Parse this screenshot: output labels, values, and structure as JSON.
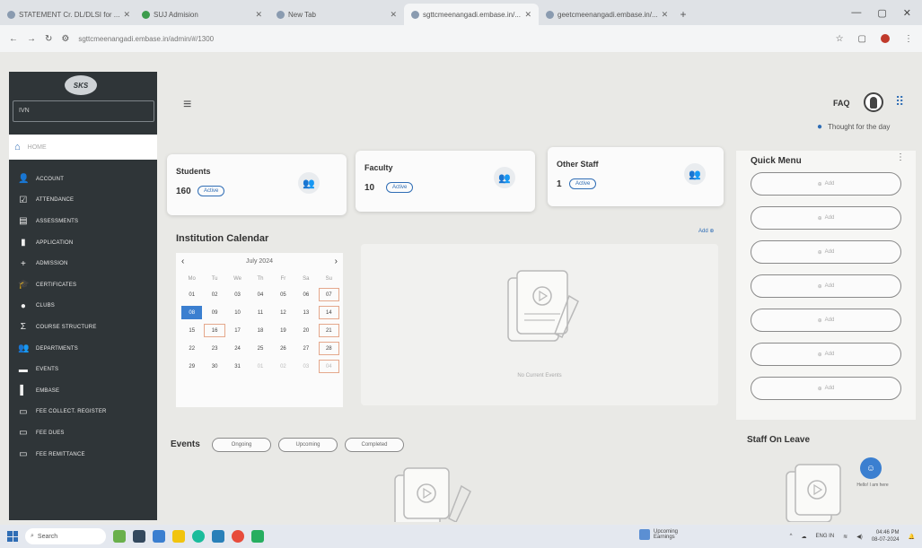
{
  "browser": {
    "tabs": [
      {
        "title": "STATEMENT Cr. DL/DLSI for ..."
      },
      {
        "title": "SUJ Admision"
      },
      {
        "title": "New Tab"
      },
      {
        "title": "sgttcmeenangadi.embase.in/..."
      },
      {
        "title": "geetcmeenangadi.embase.in/..."
      }
    ],
    "url": "sgttcmeenangadi.embase.in/admin/#/1300"
  },
  "sidebar": {
    "logo_text": "SKS",
    "search_value": "IVN",
    "home_label": "HOME",
    "items": [
      {
        "label": "ACCOUNT",
        "icon": "person-icon"
      },
      {
        "label": "ATTENDANCE",
        "icon": "check-square-icon"
      },
      {
        "label": "ASSESSMENTS",
        "icon": "clipboard-icon"
      },
      {
        "label": "APPLICATION",
        "icon": "document-icon"
      },
      {
        "label": "ADMISSION",
        "icon": "person-add-icon"
      },
      {
        "label": "CERTIFICATES",
        "icon": "graduation-cap-icon"
      },
      {
        "label": "CLUBS",
        "icon": "group-circle-icon"
      },
      {
        "label": "COURSE STRUCTURE",
        "icon": "sigma-icon"
      },
      {
        "label": "DEPARTMENTS",
        "icon": "people-icon"
      },
      {
        "label": "EVENTS",
        "icon": "event-icon"
      },
      {
        "label": "EMBASE",
        "icon": "book-icon"
      },
      {
        "label": "FEE COLLECT. REGISTER",
        "icon": "register-icon"
      },
      {
        "label": "FEE DUES",
        "icon": "fee-icon"
      },
      {
        "label": "FEE REMITTANCE",
        "icon": "remittance-icon"
      }
    ]
  },
  "header": {
    "faq_label": "FAQ",
    "thought_label": "Thought for the day"
  },
  "stats": [
    {
      "label": "Students",
      "count": "160",
      "badge": "Active"
    },
    {
      "label": "Faculty",
      "count": "10",
      "badge": "Active"
    },
    {
      "label": "Other Staff",
      "count": "1",
      "badge": "Active"
    }
  ],
  "calendar": {
    "title": "Institution Calendar",
    "month": "July 2024",
    "weekdays": [
      "Mo",
      "Tu",
      "We",
      "Th",
      "Fr",
      "Sa",
      "Su"
    ],
    "days": [
      "01",
      "02",
      "03",
      "04",
      "05",
      "06",
      "07",
      "08",
      "09",
      "10",
      "11",
      "12",
      "13",
      "14",
      "15",
      "16",
      "17",
      "18",
      "19",
      "20",
      "21",
      "22",
      "23",
      "24",
      "25",
      "26",
      "27",
      "28",
      "29",
      "30",
      "31",
      "01",
      "02",
      "03",
      "04"
    ],
    "selected_day": "08",
    "add_label": "Add",
    "empty_text": "No Current Events"
  },
  "quick_menu": {
    "title": "Quick Menu",
    "add_label": "Add",
    "button_count": 7
  },
  "events": {
    "title": "Events",
    "chips": [
      "Ongoing",
      "Upcoming",
      "Completed"
    ]
  },
  "staff_on_leave": {
    "title": "Staff On Leave",
    "help_label": "Hello! I am here"
  },
  "taskbar": {
    "search_placeholder": "Search",
    "weather_title": "Upcoming",
    "weather_sub": "Earnings",
    "lang": "ENG IN",
    "time": "04:46 PM",
    "date": "08-07-2024"
  }
}
